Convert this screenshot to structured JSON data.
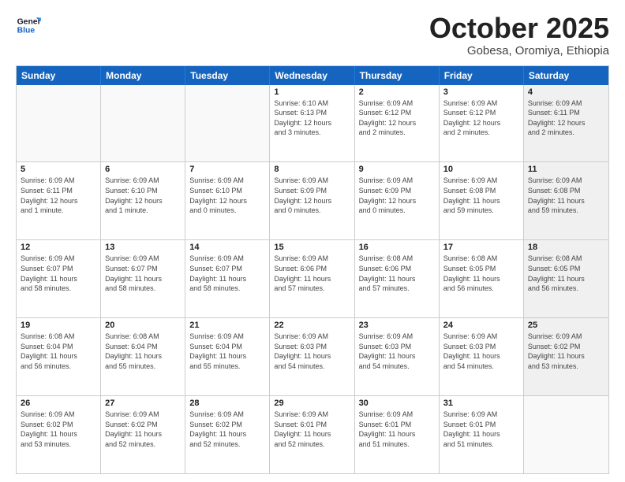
{
  "header": {
    "logo_line1": "General",
    "logo_line2": "Blue",
    "month": "October 2025",
    "location": "Gobesa, Oromiya, Ethiopia"
  },
  "day_headers": [
    "Sunday",
    "Monday",
    "Tuesday",
    "Wednesday",
    "Thursday",
    "Friday",
    "Saturday"
  ],
  "weeks": [
    [
      {
        "num": "",
        "info": "",
        "empty": true
      },
      {
        "num": "",
        "info": "",
        "empty": true
      },
      {
        "num": "",
        "info": "",
        "empty": true
      },
      {
        "num": "1",
        "info": "Sunrise: 6:10 AM\nSunset: 6:13 PM\nDaylight: 12 hours\nand 3 minutes.",
        "empty": false
      },
      {
        "num": "2",
        "info": "Sunrise: 6:09 AM\nSunset: 6:12 PM\nDaylight: 12 hours\nand 2 minutes.",
        "empty": false
      },
      {
        "num": "3",
        "info": "Sunrise: 6:09 AM\nSunset: 6:12 PM\nDaylight: 12 hours\nand 2 minutes.",
        "empty": false
      },
      {
        "num": "4",
        "info": "Sunrise: 6:09 AM\nSunset: 6:11 PM\nDaylight: 12 hours\nand 2 minutes.",
        "empty": false,
        "shaded": true
      }
    ],
    [
      {
        "num": "5",
        "info": "Sunrise: 6:09 AM\nSunset: 6:11 PM\nDaylight: 12 hours\nand 1 minute.",
        "empty": false
      },
      {
        "num": "6",
        "info": "Sunrise: 6:09 AM\nSunset: 6:10 PM\nDaylight: 12 hours\nand 1 minute.",
        "empty": false
      },
      {
        "num": "7",
        "info": "Sunrise: 6:09 AM\nSunset: 6:10 PM\nDaylight: 12 hours\nand 0 minutes.",
        "empty": false
      },
      {
        "num": "8",
        "info": "Sunrise: 6:09 AM\nSunset: 6:09 PM\nDaylight: 12 hours\nand 0 minutes.",
        "empty": false
      },
      {
        "num": "9",
        "info": "Sunrise: 6:09 AM\nSunset: 6:09 PM\nDaylight: 12 hours\nand 0 minutes.",
        "empty": false
      },
      {
        "num": "10",
        "info": "Sunrise: 6:09 AM\nSunset: 6:08 PM\nDaylight: 11 hours\nand 59 minutes.",
        "empty": false
      },
      {
        "num": "11",
        "info": "Sunrise: 6:09 AM\nSunset: 6:08 PM\nDaylight: 11 hours\nand 59 minutes.",
        "empty": false,
        "shaded": true
      }
    ],
    [
      {
        "num": "12",
        "info": "Sunrise: 6:09 AM\nSunset: 6:07 PM\nDaylight: 11 hours\nand 58 minutes.",
        "empty": false
      },
      {
        "num": "13",
        "info": "Sunrise: 6:09 AM\nSunset: 6:07 PM\nDaylight: 11 hours\nand 58 minutes.",
        "empty": false
      },
      {
        "num": "14",
        "info": "Sunrise: 6:09 AM\nSunset: 6:07 PM\nDaylight: 11 hours\nand 58 minutes.",
        "empty": false
      },
      {
        "num": "15",
        "info": "Sunrise: 6:09 AM\nSunset: 6:06 PM\nDaylight: 11 hours\nand 57 minutes.",
        "empty": false
      },
      {
        "num": "16",
        "info": "Sunrise: 6:08 AM\nSunset: 6:06 PM\nDaylight: 11 hours\nand 57 minutes.",
        "empty": false
      },
      {
        "num": "17",
        "info": "Sunrise: 6:08 AM\nSunset: 6:05 PM\nDaylight: 11 hours\nand 56 minutes.",
        "empty": false
      },
      {
        "num": "18",
        "info": "Sunrise: 6:08 AM\nSunset: 6:05 PM\nDaylight: 11 hours\nand 56 minutes.",
        "empty": false,
        "shaded": true
      }
    ],
    [
      {
        "num": "19",
        "info": "Sunrise: 6:08 AM\nSunset: 6:04 PM\nDaylight: 11 hours\nand 56 minutes.",
        "empty": false
      },
      {
        "num": "20",
        "info": "Sunrise: 6:08 AM\nSunset: 6:04 PM\nDaylight: 11 hours\nand 55 minutes.",
        "empty": false
      },
      {
        "num": "21",
        "info": "Sunrise: 6:09 AM\nSunset: 6:04 PM\nDaylight: 11 hours\nand 55 minutes.",
        "empty": false
      },
      {
        "num": "22",
        "info": "Sunrise: 6:09 AM\nSunset: 6:03 PM\nDaylight: 11 hours\nand 54 minutes.",
        "empty": false
      },
      {
        "num": "23",
        "info": "Sunrise: 6:09 AM\nSunset: 6:03 PM\nDaylight: 11 hours\nand 54 minutes.",
        "empty": false
      },
      {
        "num": "24",
        "info": "Sunrise: 6:09 AM\nSunset: 6:03 PM\nDaylight: 11 hours\nand 54 minutes.",
        "empty": false
      },
      {
        "num": "25",
        "info": "Sunrise: 6:09 AM\nSunset: 6:02 PM\nDaylight: 11 hours\nand 53 minutes.",
        "empty": false,
        "shaded": true
      }
    ],
    [
      {
        "num": "26",
        "info": "Sunrise: 6:09 AM\nSunset: 6:02 PM\nDaylight: 11 hours\nand 53 minutes.",
        "empty": false
      },
      {
        "num": "27",
        "info": "Sunrise: 6:09 AM\nSunset: 6:02 PM\nDaylight: 11 hours\nand 52 minutes.",
        "empty": false
      },
      {
        "num": "28",
        "info": "Sunrise: 6:09 AM\nSunset: 6:02 PM\nDaylight: 11 hours\nand 52 minutes.",
        "empty": false
      },
      {
        "num": "29",
        "info": "Sunrise: 6:09 AM\nSunset: 6:01 PM\nDaylight: 11 hours\nand 52 minutes.",
        "empty": false
      },
      {
        "num": "30",
        "info": "Sunrise: 6:09 AM\nSunset: 6:01 PM\nDaylight: 11 hours\nand 51 minutes.",
        "empty": false
      },
      {
        "num": "31",
        "info": "Sunrise: 6:09 AM\nSunset: 6:01 PM\nDaylight: 11 hours\nand 51 minutes.",
        "empty": false
      },
      {
        "num": "",
        "info": "",
        "empty": true,
        "shaded": true
      }
    ]
  ]
}
